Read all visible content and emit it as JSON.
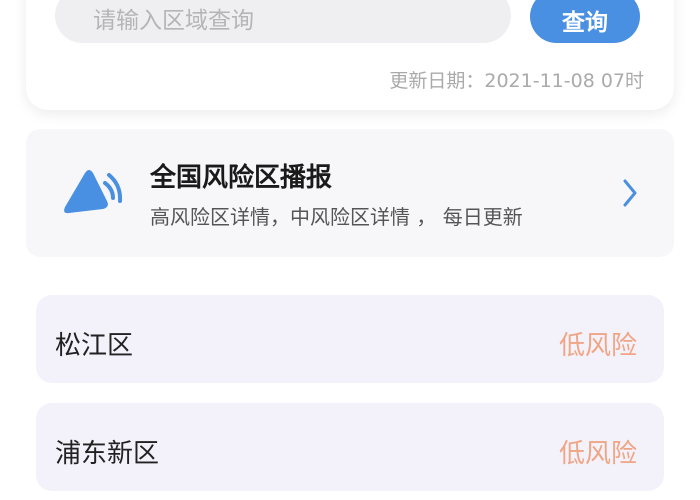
{
  "search": {
    "placeholder": "请输入区域查询",
    "button_label": "查询",
    "update_text": "更新日期：2021-11-08 07时"
  },
  "broadcast": {
    "icon": "broadcast-triangle-icon",
    "title": "全国风险区播报",
    "subtitle": "高风险区详情，中风险区详情 ， 每日更新"
  },
  "regions": [
    {
      "name": "松江区",
      "level": "低风险"
    },
    {
      "name": "浦东新区",
      "level": "低风险"
    }
  ],
  "colors": {
    "accent": "#4a90e2",
    "low_risk": "#f0a585",
    "region_bg": "#f3f2fb",
    "card_bg": "#f7f7f9"
  }
}
